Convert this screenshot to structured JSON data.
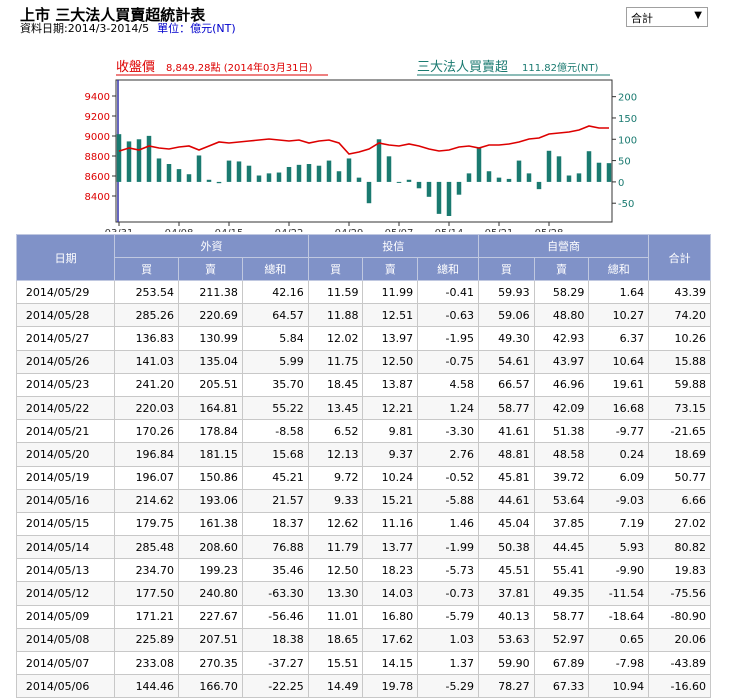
{
  "header": {
    "title": "上市 三大法人買賣超統計表",
    "date_range": "資料日期:2014/3-2014/5",
    "unit": "單位：億元(NT)"
  },
  "selector": {
    "value": "合計"
  },
  "chart_data": {
    "type": "line+bar",
    "price_title": "收盤價",
    "price_info": "8,849.28點 (2014年03月31日)",
    "net_title": "三大法人買賣超",
    "net_info": "111.82億元(NT)",
    "left_axis": {
      "min": 8200,
      "max": 9500,
      "ticks": [
        8400,
        8600,
        8800,
        9000,
        9200,
        9400
      ]
    },
    "right_axis": {
      "min": -80,
      "max": 225,
      "ticks": [
        -50,
        0,
        50,
        100,
        150,
        200
      ]
    },
    "x_tick_labels": [
      "03/31",
      "04/08",
      "04/15",
      "04/22",
      "04/29",
      "05/07",
      "05/14",
      "05/21",
      "05/28"
    ],
    "x_tick_indices": [
      0,
      6,
      11,
      17,
      23,
      28,
      33,
      38,
      43
    ],
    "price_color": "#dd0000",
    "bar_color": "#1a7a70",
    "price": [
      8849,
      8880,
      8860,
      8900,
      8880,
      8870,
      8890,
      8900,
      8860,
      8900,
      8940,
      8930,
      8940,
      8950,
      8960,
      8970,
      8960,
      8950,
      8960,
      8930,
      8950,
      8960,
      8930,
      8820,
      8840,
      8870,
      8930,
      8910,
      8900,
      8920,
      8900,
      8870,
      8850,
      8860,
      8890,
      8900,
      8880,
      8910,
      8910,
      8920,
      8940,
      8970,
      8980,
      9020,
      9030,
      9040,
      9060,
      9100,
      9080,
      9080
    ],
    "net": [
      112,
      95,
      100,
      108,
      55,
      42,
      30,
      18,
      62,
      5,
      -3,
      50,
      48,
      38,
      15,
      20,
      22,
      35,
      40,
      42,
      38,
      50,
      25,
      55,
      10,
      -50,
      100,
      60,
      0,
      5,
      -15,
      -35,
      -75,
      -80,
      -30,
      20,
      81,
      25,
      10,
      7,
      50,
      20,
      -17,
      73,
      60,
      15,
      20,
      72,
      45,
      44
    ]
  },
  "table": {
    "group_headers": [
      "日期",
      "外資",
      "投信",
      "自營商",
      "合計"
    ],
    "sub_headers": [
      "買",
      "賣",
      "總和",
      "買",
      "賣",
      "總和",
      "買",
      "賣",
      "總和"
    ],
    "rows": [
      [
        "2014/05/29",
        "253.54",
        "211.38",
        "42.16",
        "11.59",
        "11.99",
        "-0.41",
        "59.93",
        "58.29",
        "1.64",
        "43.39"
      ],
      [
        "2014/05/28",
        "285.26",
        "220.69",
        "64.57",
        "11.88",
        "12.51",
        "-0.63",
        "59.06",
        "48.80",
        "10.27",
        "74.20"
      ],
      [
        "2014/05/27",
        "136.83",
        "130.99",
        "5.84",
        "12.02",
        "13.97",
        "-1.95",
        "49.30",
        "42.93",
        "6.37",
        "10.26"
      ],
      [
        "2014/05/26",
        "141.03",
        "135.04",
        "5.99",
        "11.75",
        "12.50",
        "-0.75",
        "54.61",
        "43.97",
        "10.64",
        "15.88"
      ],
      [
        "2014/05/23",
        "241.20",
        "205.51",
        "35.70",
        "18.45",
        "13.87",
        "4.58",
        "66.57",
        "46.96",
        "19.61",
        "59.88"
      ],
      [
        "2014/05/22",
        "220.03",
        "164.81",
        "55.22",
        "13.45",
        "12.21",
        "1.24",
        "58.77",
        "42.09",
        "16.68",
        "73.15"
      ],
      [
        "2014/05/21",
        "170.26",
        "178.84",
        "-8.58",
        "6.52",
        "9.81",
        "-3.30",
        "41.61",
        "51.38",
        "-9.77",
        "-21.65"
      ],
      [
        "2014/05/20",
        "196.84",
        "181.15",
        "15.68",
        "12.13",
        "9.37",
        "2.76",
        "48.81",
        "48.58",
        "0.24",
        "18.69"
      ],
      [
        "2014/05/19",
        "196.07",
        "150.86",
        "45.21",
        "9.72",
        "10.24",
        "-0.52",
        "45.81",
        "39.72",
        "6.09",
        "50.77"
      ],
      [
        "2014/05/16",
        "214.62",
        "193.06",
        "21.57",
        "9.33",
        "15.21",
        "-5.88",
        "44.61",
        "53.64",
        "-9.03",
        "6.66"
      ],
      [
        "2014/05/15",
        "179.75",
        "161.38",
        "18.37",
        "12.62",
        "11.16",
        "1.46",
        "45.04",
        "37.85",
        "7.19",
        "27.02"
      ],
      [
        "2014/05/14",
        "285.48",
        "208.60",
        "76.88",
        "11.79",
        "13.77",
        "-1.99",
        "50.38",
        "44.45",
        "5.93",
        "80.82"
      ],
      [
        "2014/05/13",
        "234.70",
        "199.23",
        "35.46",
        "12.50",
        "18.23",
        "-5.73",
        "45.51",
        "55.41",
        "-9.90",
        "19.83"
      ],
      [
        "2014/05/12",
        "177.50",
        "240.80",
        "-63.30",
        "13.30",
        "14.03",
        "-0.73",
        "37.81",
        "49.35",
        "-11.54",
        "-75.56"
      ],
      [
        "2014/05/09",
        "171.21",
        "227.67",
        "-56.46",
        "11.01",
        "16.80",
        "-5.79",
        "40.13",
        "58.77",
        "-18.64",
        "-80.90"
      ],
      [
        "2014/05/08",
        "225.89",
        "207.51",
        "18.38",
        "18.65",
        "17.62",
        "1.03",
        "53.63",
        "52.97",
        "0.65",
        "20.06"
      ],
      [
        "2014/05/07",
        "233.08",
        "270.35",
        "-37.27",
        "15.51",
        "14.15",
        "1.37",
        "59.90",
        "67.89",
        "-7.98",
        "-43.89"
      ],
      [
        "2014/05/06",
        "144.46",
        "166.70",
        "-22.25",
        "14.49",
        "19.78",
        "-5.29",
        "78.27",
        "67.33",
        "10.94",
        "-16.60"
      ]
    ]
  }
}
